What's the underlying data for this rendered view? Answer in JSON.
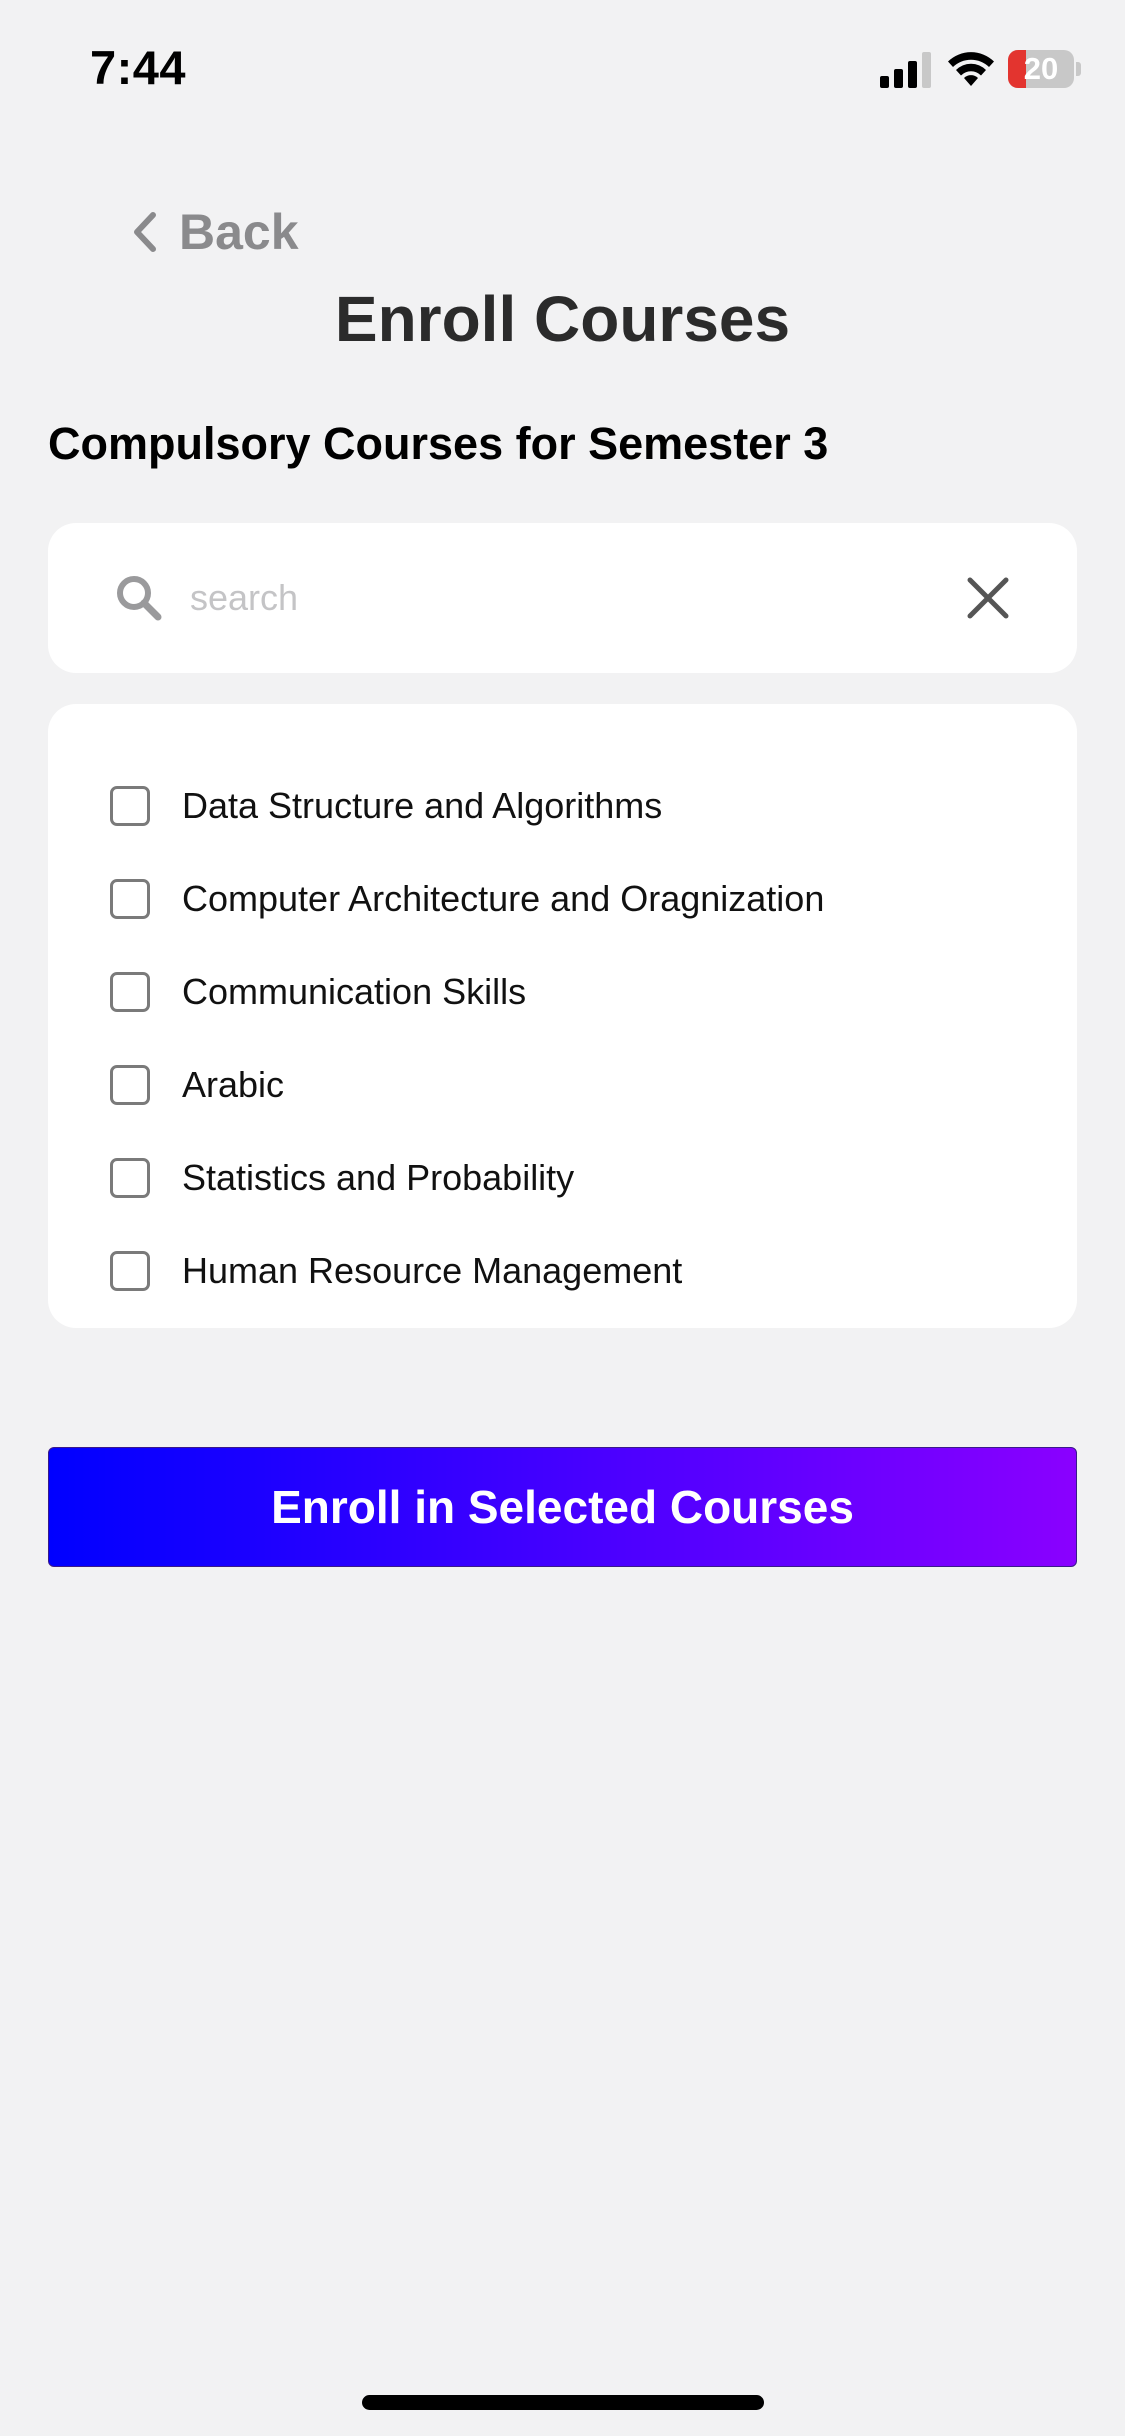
{
  "status_bar": {
    "time": "7:44",
    "battery_level": "20",
    "signal_icon": "cellular-signal-icon",
    "wifi_icon": "wifi-icon",
    "battery_low_color": "#e3342f"
  },
  "header": {
    "back_label": "Back",
    "back_icon": "chevron-left-icon",
    "title": "Enroll Courses"
  },
  "section": {
    "title": "Compulsory Courses for Semester 3"
  },
  "search": {
    "placeholder": "search",
    "value": "",
    "search_icon": "search-icon",
    "clear_icon": "close-icon"
  },
  "courses": [
    {
      "label": "Data Structure and Algorithms",
      "checked": false
    },
    {
      "label": "Computer Architecture and Oragnization",
      "checked": false
    },
    {
      "label": "Communication Skills",
      "checked": false
    },
    {
      "label": "Arabic",
      "checked": false
    },
    {
      "label": "Statistics and Probability",
      "checked": false
    },
    {
      "label": "Human Resource Management",
      "checked": false
    }
  ],
  "actions": {
    "enroll_label": "Enroll in Selected Courses",
    "gradient_start": "#0000ff",
    "gradient_end": "#8a00ff"
  }
}
